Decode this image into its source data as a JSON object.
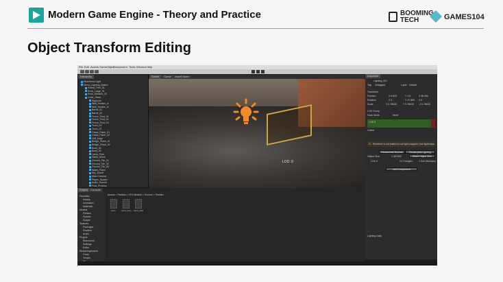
{
  "header": {
    "course_title": "Modern Game Engine - Theory and Practice",
    "brand_booming_line1": "BOOMING",
    "brand_booming_line2": "TECH",
    "brand_games": "GAMES104"
  },
  "slide": {
    "section_title": "Object Transform Editing"
  },
  "editor": {
    "menu": [
      "File",
      "Edit",
      "Assets",
      "GameObject",
      "Component",
      "Tools",
      "Window",
      "Help"
    ],
    "scene_tabs": [
      "Scene",
      "Game",
      "Asset Store"
    ],
    "hierarchy_tab": "Hierarchy",
    "hierarchy_rows": [
      "Directional Light",
      "Demo_Lighting_Baked",
      "Forest_Tree_01",
      "Rock_Large_01",
      "Rock_Medium_02",
      "Crate_Stack",
      "Signpost",
      "Wall_Section_A",
      "Wall_Section_B",
      "Barrel_01",
      "Barrel_02",
      "Fence_Post_01",
      "Fence_Post_02",
      "Fence_Post_03",
      "Torch_01",
      "Torch_02",
      "Grass_Patch_01",
      "Grass_Patch_02",
      "Cliff_Edge",
      "Bridge_Plank_01",
      "Bridge_Plank_02",
      "Bush_01",
      "Bush_02",
      "Lamp_Post",
      "Stairs_Stone",
      "Ground_Tile_01",
      "Ground_Tile_02",
      "Ground_Tile_03",
      "Water_Plane",
      "Sky_Dome",
      "Main Camera",
      "Player_Spawn",
      "Audio_Source",
      "Post_Process"
    ],
    "scene_overlay_label": "LOD: 0",
    "inspector_tab": "Inspector",
    "inspector_object": "Lighting_001",
    "inspector_tag_label": "Tag",
    "inspector_tag_value": "Untagged",
    "inspector_layer_label": "Layer",
    "inspector_layer_value": "Default",
    "transform_header": "Transform",
    "position_label": "Position",
    "rotation_label": "Rotation",
    "scale_label": "Scale",
    "position_values": [
      "X 6.803",
      "Y 1.8",
      "Z 48.496"
    ],
    "rotation_values": [
      "X 0",
      "Y 47.663",
      "Z 0"
    ],
    "scale_values": [
      "X 0.78633",
      "Y 0.78633",
      "Z 0.78633"
    ],
    "lod_group_header": "LOD Group",
    "fade_mode_label": "Fade Mode",
    "fade_mode_value": "None",
    "lod_bar_label": "LOD 0",
    "culled_label": "Culled",
    "warning_text": "Renderer is not baked or not light-mapped. Use lightmaps.",
    "recalc_bounds_button": "Recalculate Bounds",
    "recalc_lighting_button": "Recalculate Lighting Scales",
    "object_size_label": "Object Size",
    "object_size_value": "1.357895",
    "reset_object_size_button": "Reset Object Size",
    "lod0_info": "LOD 0",
    "triangles_info": "14 Triangles",
    "submesh_info": "1 Sub Mesh(es)",
    "add_component_button": "Add Component",
    "lighting_footer": "Lighting Data",
    "project_tab": "Project",
    "console_tab": "Console",
    "breadcrumb": "Assets > Prefabs > VFX Models > Torches > Prefabs",
    "project_folders": [
      "Favorites",
      "Assets",
      "Animation",
      "Materials",
      "Models",
      "Prefabs",
      "Scenes",
      "Scripts",
      "Textures",
      "Packages",
      "Shaders",
      "Audio",
      "Plugins",
      "Resources",
      "Settings",
      "Editor",
      "StreamingAssets",
      "Fonts",
      "Terrain",
      "UI"
    ],
    "assets": [
      "torch",
      "torch_lod1",
      "torch_lod2"
    ]
  },
  "colors": {
    "accent_teal": "#1aa59a",
    "light_orange": "#f08a2a",
    "hierarchy_icon_blue": "#4aa8e0"
  }
}
